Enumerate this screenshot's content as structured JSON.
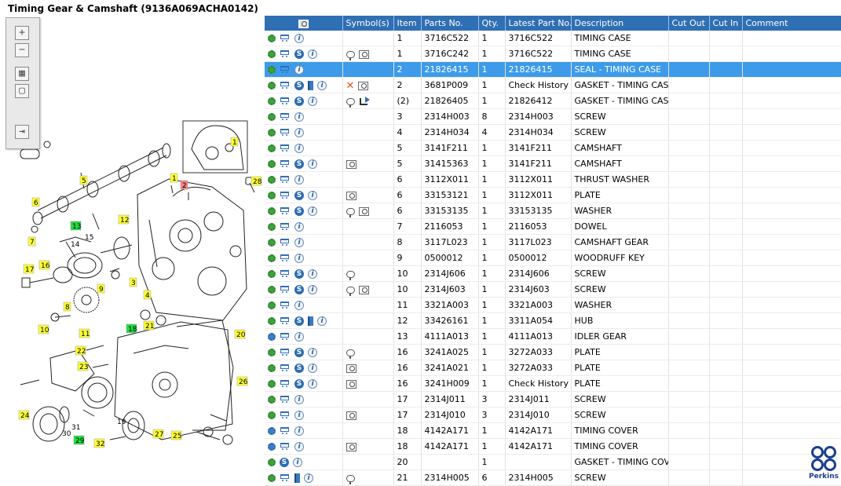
{
  "title": "Timing Gear & Camshaft (9136A069ACHA0142)",
  "zoom_tools": {
    "zoom_in": "+",
    "zoom_out": "−",
    "fit": "▦",
    "actual": "▢",
    "export": "⇥"
  },
  "columns": [
    "",
    "Symbol(s)",
    "Item",
    "Parts No.",
    "Qty.",
    "Latest Part No.",
    "Description",
    "Cut Out",
    "Cut In",
    "Comment"
  ],
  "header_icon": "magnifier-icon",
  "rows": [
    {
      "icons": [
        "gear",
        "cart",
        "info"
      ],
      "sym": [],
      "item": "1",
      "part": "3716C522",
      "qty": "1",
      "latest": "3716C522",
      "desc": "TIMING CASE"
    },
    {
      "icons": [
        "gear",
        "cart",
        "s",
        "info"
      ],
      "sym": [
        "bubble",
        "mag"
      ],
      "item": "1",
      "part": "3716C242",
      "qty": "1",
      "latest": "3716C522",
      "desc": "TIMING CASE"
    },
    {
      "icons": [
        "gear",
        "cart",
        "info"
      ],
      "sym": [],
      "item": "2",
      "part": "21826415",
      "qty": "1",
      "latest": "21826415",
      "desc": "SEAL - TIMING CASE",
      "selected": true
    },
    {
      "icons": [
        "gear",
        "cart",
        "s",
        "book",
        "info"
      ],
      "sym": [
        "x",
        "mag"
      ],
      "item": "2",
      "part": "3681P009",
      "qty": "1",
      "latest": "Check History",
      "desc": "GASKET - TIMING CASE"
    },
    {
      "icons": [
        "gear",
        "cart",
        "s",
        "info"
      ],
      "sym": [
        "bubble",
        "redir"
      ],
      "item": "(2)",
      "part": "21826405",
      "qty": "1",
      "latest": "21826412",
      "desc": "GASKET - TIMING CASE"
    },
    {
      "icons": [
        "gear",
        "cart",
        "info"
      ],
      "sym": [],
      "item": "3",
      "part": "2314H003",
      "qty": "8",
      "latest": "2314H003",
      "desc": "SCREW"
    },
    {
      "icons": [
        "gear",
        "cart",
        "info"
      ],
      "sym": [],
      "item": "4",
      "part": "2314H034",
      "qty": "4",
      "latest": "2314H034",
      "desc": "SCREW"
    },
    {
      "icons": [
        "gear",
        "cart",
        "info"
      ],
      "sym": [],
      "item": "5",
      "part": "3141F211",
      "qty": "1",
      "latest": "3141F211",
      "desc": "CAMSHAFT"
    },
    {
      "icons": [
        "gear",
        "cart",
        "s",
        "info"
      ],
      "sym": [
        "mag"
      ],
      "item": "5",
      "part": "31415363",
      "qty": "1",
      "latest": "3141F211",
      "desc": "CAMSHAFT"
    },
    {
      "icons": [
        "gear",
        "cart",
        "info"
      ],
      "sym": [],
      "item": "6",
      "part": "3112X011",
      "qty": "1",
      "latest": "3112X011",
      "desc": "THRUST WASHER"
    },
    {
      "icons": [
        "gear",
        "cart",
        "s",
        "info"
      ],
      "sym": [
        "mag"
      ],
      "item": "6",
      "part": "33153121",
      "qty": "1",
      "latest": "3112X011",
      "desc": "PLATE"
    },
    {
      "icons": [
        "gear",
        "cart",
        "s",
        "info"
      ],
      "sym": [
        "bubble",
        "mag"
      ],
      "item": "6",
      "part": "33153135",
      "qty": "1",
      "latest": "33153135",
      "desc": "WASHER"
    },
    {
      "icons": [
        "gear",
        "cart",
        "info"
      ],
      "sym": [],
      "item": "7",
      "part": "2116053",
      "qty": "1",
      "latest": "2116053",
      "desc": "DOWEL"
    },
    {
      "icons": [
        "gear",
        "cart",
        "info"
      ],
      "sym": [],
      "item": "8",
      "part": "3117L023",
      "qty": "1",
      "latest": "3117L023",
      "desc": "CAMSHAFT GEAR"
    },
    {
      "icons": [
        "gear",
        "cart",
        "info"
      ],
      "sym": [],
      "item": "9",
      "part": "0500012",
      "qty": "1",
      "latest": "0500012",
      "desc": "WOODRUFF KEY"
    },
    {
      "icons": [
        "gear",
        "cart",
        "s",
        "info"
      ],
      "sym": [
        "bubble"
      ],
      "item": "10",
      "part": "2314J606",
      "qty": "1",
      "latest": "2314J606",
      "desc": "SCREW"
    },
    {
      "icons": [
        "gear",
        "cart",
        "s",
        "info"
      ],
      "sym": [
        "bubble",
        "mag"
      ],
      "item": "10",
      "part": "2314J603",
      "qty": "1",
      "latest": "2314J603",
      "desc": "SCREW"
    },
    {
      "icons": [
        "gear",
        "cart",
        "info"
      ],
      "sym": [],
      "item": "11",
      "part": "3321A003",
      "qty": "1",
      "latest": "3321A003",
      "desc": "WASHER"
    },
    {
      "icons": [
        "gear",
        "cart",
        "s",
        "book",
        "info"
      ],
      "sym": [],
      "item": "12",
      "part": "33426161",
      "qty": "1",
      "latest": "3311A054",
      "desc": "HUB"
    },
    {
      "icons": [
        "gearblue",
        "cart",
        "info"
      ],
      "sym": [],
      "item": "13",
      "part": "4111A013",
      "qty": "1",
      "latest": "4111A013",
      "desc": "IDLER GEAR"
    },
    {
      "icons": [
        "gear",
        "cart",
        "s",
        "info"
      ],
      "sym": [
        "bubble"
      ],
      "item": "16",
      "part": "3241A025",
      "qty": "1",
      "latest": "3272A033",
      "desc": "PLATE"
    },
    {
      "icons": [
        "gear",
        "cart",
        "s",
        "info"
      ],
      "sym": [
        "mag"
      ],
      "item": "16",
      "part": "3241A021",
      "qty": "1",
      "latest": "3272A033",
      "desc": "PLATE"
    },
    {
      "icons": [
        "gear",
        "cart",
        "s",
        "info"
      ],
      "sym": [
        "mag"
      ],
      "item": "16",
      "part": "3241H009",
      "qty": "1",
      "latest": "Check History",
      "desc": "PLATE"
    },
    {
      "icons": [
        "gear",
        "cart",
        "info"
      ],
      "sym": [],
      "item": "17",
      "part": "2314J011",
      "qty": "3",
      "latest": "2314J011",
      "desc": "SCREW"
    },
    {
      "icons": [
        "gear",
        "cart",
        "info"
      ],
      "sym": [
        "mag"
      ],
      "item": "17",
      "part": "2314J010",
      "qty": "3",
      "latest": "2314J010",
      "desc": "SCREW"
    },
    {
      "icons": [
        "gearblue",
        "cart",
        "info"
      ],
      "sym": [],
      "item": "18",
      "part": "4142A171",
      "qty": "1",
      "latest": "4142A171",
      "desc": "TIMING COVER"
    },
    {
      "icons": [
        "gearblue",
        "cart",
        "info"
      ],
      "sym": [
        "mag"
      ],
      "item": "18",
      "part": "4142A171",
      "qty": "1",
      "latest": "4142A171",
      "desc": "TIMING COVER"
    },
    {
      "icons": [
        "gear",
        "s",
        "info"
      ],
      "sym": [],
      "item": "20",
      "part": "",
      "qty": "1",
      "latest": "",
      "desc": "GASKET - TIMING COVE"
    },
    {
      "icons": [
        "gear",
        "cart",
        "book",
        "info"
      ],
      "sym": [
        "bubble"
      ],
      "item": "21",
      "part": "2314H005",
      "qty": "6",
      "latest": "2314H005",
      "desc": "SCREW"
    }
  ],
  "callouts": [
    {
      "t": "1",
      "hl": "yellow"
    },
    {
      "t": "1",
      "hl": "yellow"
    },
    {
      "t": "2",
      "hl": "red"
    },
    {
      "t": "3",
      "hl": "yellow"
    },
    {
      "t": "4",
      "hl": "yellow"
    },
    {
      "t": "5",
      "hl": "yellow"
    },
    {
      "t": "6",
      "hl": "yellow"
    },
    {
      "t": "7",
      "hl": "yellow"
    },
    {
      "t": "8",
      "hl": "yellow"
    },
    {
      "t": "9",
      "hl": "yellow"
    },
    {
      "t": "10",
      "hl": "yellow"
    },
    {
      "t": "11",
      "hl": "yellow"
    },
    {
      "t": "12",
      "hl": "yellow"
    },
    {
      "t": "13",
      "hl": "green"
    },
    {
      "t": "14",
      "hl": "none"
    },
    {
      "t": "15",
      "hl": "none"
    },
    {
      "t": "16",
      "hl": "yellow"
    },
    {
      "t": "17",
      "hl": "yellow"
    },
    {
      "t": "18",
      "hl": "green"
    },
    {
      "t": "19",
      "hl": "none"
    },
    {
      "t": "20",
      "hl": "yellow"
    },
    {
      "t": "21",
      "hl": "yellow"
    },
    {
      "t": "22",
      "hl": "yellow"
    },
    {
      "t": "23",
      "hl": "yellow"
    },
    {
      "t": "24",
      "hl": "yellow"
    },
    {
      "t": "25",
      "hl": "yellow"
    },
    {
      "t": "26",
      "hl": "yellow"
    },
    {
      "t": "27",
      "hl": "yellow"
    },
    {
      "t": "28",
      "hl": "yellow"
    },
    {
      "t": "29",
      "hl": "green"
    },
    {
      "t": "30",
      "hl": "none"
    },
    {
      "t": "31",
      "hl": "none"
    },
    {
      "t": "32",
      "hl": "yellow"
    }
  ],
  "logo_text": "Perkins",
  "colors": {
    "header": "#2f6fb4",
    "selected": "#3d9be9",
    "callout_yellow": "#ffff33",
    "callout_green": "#22dd44",
    "callout_red": "#ff8080"
  }
}
